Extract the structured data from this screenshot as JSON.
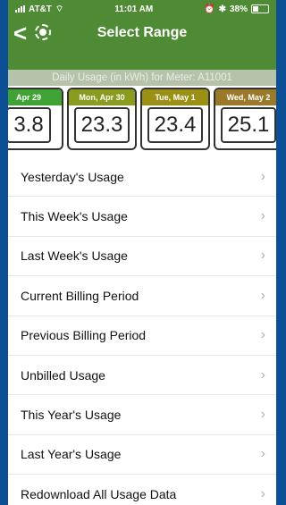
{
  "status": {
    "carrier": "AT&T",
    "time": "11:01 AM",
    "battery": "38%"
  },
  "header": {
    "title": "Select Range"
  },
  "meter_bar": "Daily Usage (in kWh) for Meter: A11001",
  "cards": [
    {
      "date": "Apr 29",
      "value": "3.8",
      "color": "#3ea334"
    },
    {
      "date": "Mon, Apr 30",
      "value": "23.3",
      "color": "#8a9b20"
    },
    {
      "date": "Tue, May 1",
      "value": "23.4",
      "color": "#9a9016"
    },
    {
      "date": "Wed, May 2",
      "value": "25.1",
      "color": "#9a7a2a"
    }
  ],
  "list": [
    {
      "label": "Yesterday's Usage"
    },
    {
      "label": "This Week's Usage"
    },
    {
      "label": "Last Week's Usage"
    },
    {
      "label": "Current Billing Period"
    },
    {
      "label": "Previous Billing Period"
    },
    {
      "label": "Unbilled Usage"
    },
    {
      "label": "This Year's Usage"
    },
    {
      "label": "Last Year's Usage"
    },
    {
      "label": "Redownload All Usage Data"
    }
  ],
  "icons": {
    "chevron": "›",
    "back": "<"
  }
}
